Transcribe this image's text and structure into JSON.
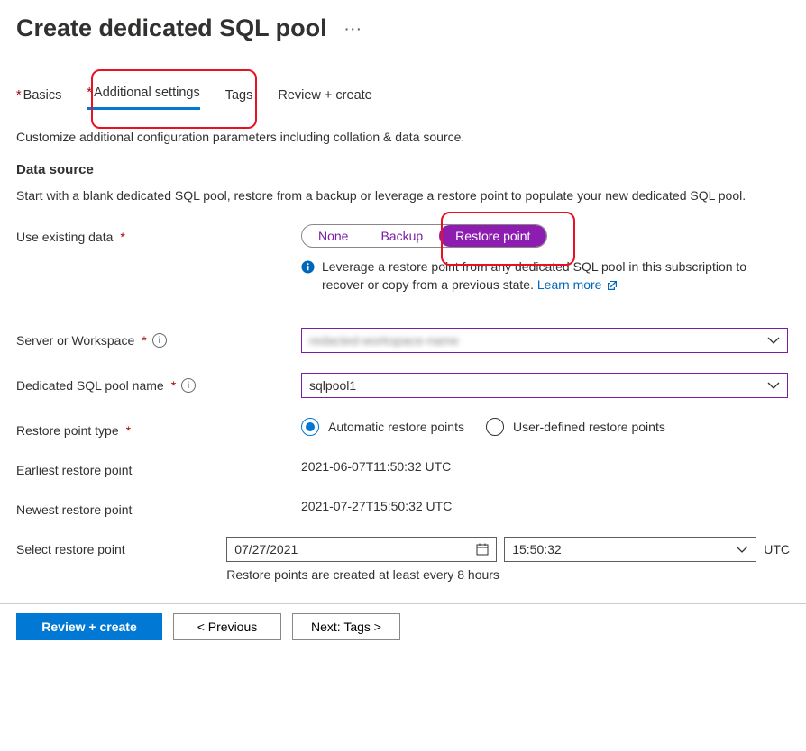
{
  "header": {
    "title": "Create dedicated SQL pool"
  },
  "tabs": {
    "basics": "Basics",
    "additional": "Additional settings",
    "tags": "Tags",
    "review": "Review + create"
  },
  "intro": "Customize additional configuration parameters including collation & data source.",
  "dataSource": {
    "heading": "Data source",
    "paragraph": "Start with a blank dedicated SQL pool, restore from a backup or leverage a restore point to populate your new dedicated SQL pool.",
    "useExistingLabel": "Use existing data",
    "options": {
      "none": "None",
      "backup": "Backup",
      "restore": "Restore point"
    },
    "infoText": "Leverage a restore point from any dedicated SQL pool in this subscription to recover or copy from a previous state. ",
    "learnMore": "Learn more"
  },
  "fields": {
    "serverLabel": "Server or Workspace",
    "serverValue": "redacted-workspace-name",
    "poolNameLabel": "Dedicated SQL pool name",
    "poolNameValue": "sqlpool1",
    "restoreTypeLabel": "Restore point type",
    "restoreTypeOptions": {
      "auto": "Automatic restore points",
      "user": "User-defined restore points"
    },
    "earliestLabel": "Earliest restore point",
    "earliestValue": "2021-06-07T11:50:32 UTC",
    "newestLabel": "Newest restore point",
    "newestValue": "2021-07-27T15:50:32 UTC",
    "selectLabel": "Select restore point",
    "dateValue": "07/27/2021",
    "timeValue": "15:50:32",
    "tzLabel": "UTC",
    "restoreHint": "Restore points are created at least every 8 hours"
  },
  "footer": {
    "review": "Review + create",
    "previous": "< Previous",
    "next": "Next: Tags >"
  }
}
